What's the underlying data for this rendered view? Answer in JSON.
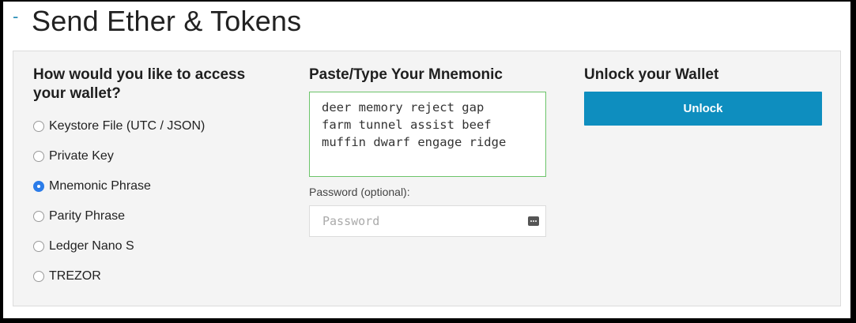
{
  "header": {
    "collapse_symbol": "-",
    "title": "Send Ether & Tokens"
  },
  "access": {
    "heading": "How would you like to access your wallet?",
    "options": [
      {
        "label": "Keystore File (UTC / JSON)",
        "selected": false
      },
      {
        "label": "Private Key",
        "selected": false
      },
      {
        "label": "Mnemonic Phrase",
        "selected": true
      },
      {
        "label": "Parity Phrase",
        "selected": false
      },
      {
        "label": "Ledger Nano S",
        "selected": false
      },
      {
        "label": "TREZOR",
        "selected": false
      }
    ]
  },
  "mnemonic": {
    "heading": "Paste/Type Your Mnemonic",
    "value": "deer memory reject gap\nfarm tunnel assist beef\nmuffin dwarf engage ridge",
    "password_label": "Password (optional):",
    "password_placeholder": "Password",
    "password_icon": "password-manager-key-icon"
  },
  "unlock": {
    "heading": "Unlock your Wallet",
    "button_label": "Unlock"
  },
  "colors": {
    "accent": "#0e8ebf",
    "radio_selected": "#2b7ce9",
    "textarea_focus_border": "#6cc46a",
    "panel_bg": "#f4f4f4"
  }
}
